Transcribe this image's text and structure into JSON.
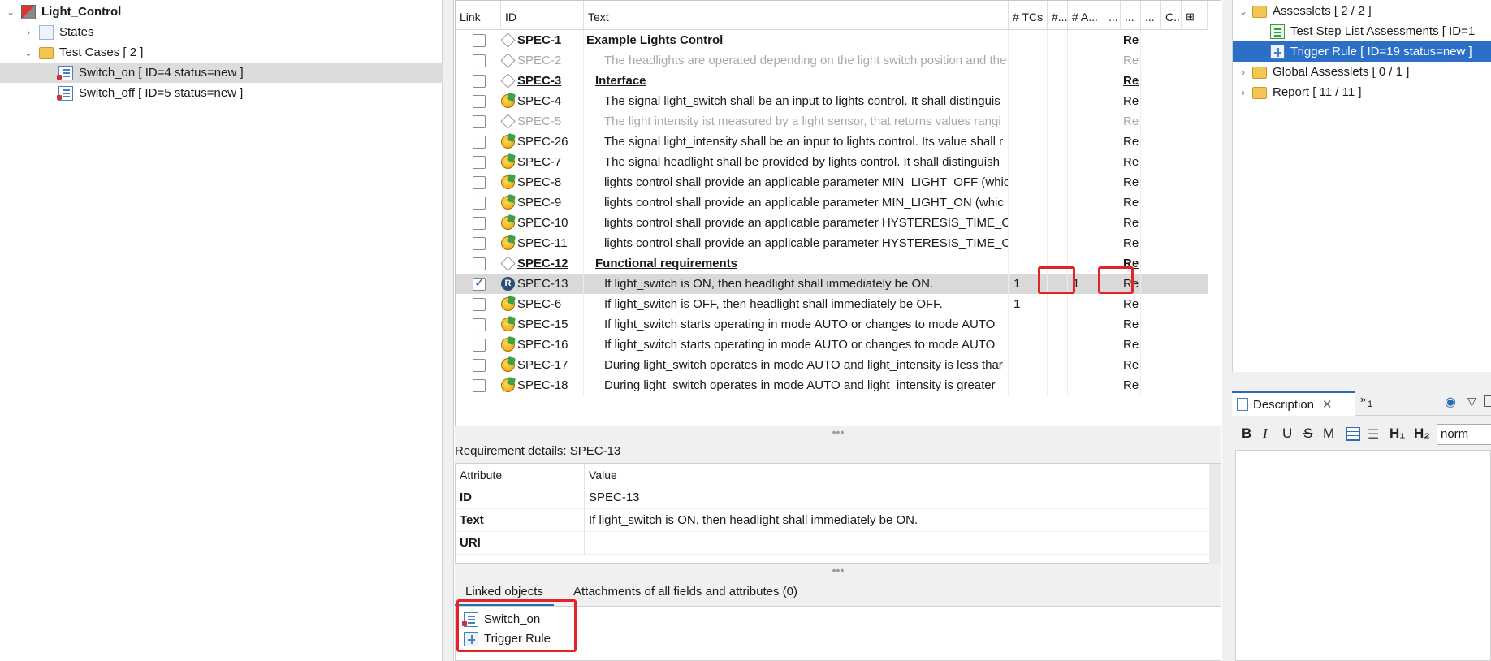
{
  "left_tree": {
    "root": "Light_Control",
    "states": "States",
    "test_cases": "Test Cases  [ 2 ]",
    "switch_on": "Switch_on  [ ID=4 status=new ]",
    "switch_off": "Switch_off  [ ID=5 status=new ]"
  },
  "grid": {
    "headers": [
      "Link",
      "ID",
      "Text",
      "# TCs",
      "#...",
      "# A...",
      "...",
      "...",
      "...",
      "C..."
    ],
    "rows": [
      {
        "id": "SPEC-1",
        "text": "Example Lights Control",
        "tcs": "",
        "a": "",
        "re": "Re",
        "checked": false,
        "icon": "diamond",
        "style": "heading"
      },
      {
        "id": "SPEC-2",
        "text": "The headlights are operated depending on the light switch position and the",
        "tcs": "",
        "a": "",
        "re": "Re",
        "checked": false,
        "icon": "diamond",
        "style": "grey"
      },
      {
        "id": "SPEC-3",
        "text": "Interface",
        "tcs": "",
        "a": "",
        "re": "Re",
        "checked": false,
        "icon": "diamond",
        "style": "heading2"
      },
      {
        "id": "SPEC-4",
        "text": "The signal light_switch shall be an input to lights control. It shall distinguis",
        "tcs": "",
        "a": "",
        "re": "Re",
        "checked": false,
        "icon": "bulb",
        "style": "normal"
      },
      {
        "id": "SPEC-5",
        "text": "The light intensity ist measured by a light sensor, that returns values rangi",
        "tcs": "",
        "a": "",
        "re": "Re",
        "checked": false,
        "icon": "diamond",
        "style": "grey"
      },
      {
        "id": "SPEC-26",
        "text": "The signal light_intensity shall be an input to lights control. Its value shall r",
        "tcs": "",
        "a": "",
        "re": "Re",
        "checked": false,
        "icon": "bulb",
        "style": "normal"
      },
      {
        "id": "SPEC-7",
        "text": "The signal headlight shall be provided by lights control. It shall distinguish",
        "tcs": "",
        "a": "",
        "re": "Re",
        "checked": false,
        "icon": "bulb",
        "style": "normal"
      },
      {
        "id": "SPEC-8",
        "text": "lights control shall provide an applicable parameter MIN_LIGHT_OFF (whic",
        "tcs": "",
        "a": "",
        "re": "Re",
        "checked": false,
        "icon": "bulb",
        "style": "normal"
      },
      {
        "id": "SPEC-9",
        "text": "lights control shall provide an applicable parameter MIN_LIGHT_ON (whic",
        "tcs": "",
        "a": "",
        "re": "Re",
        "checked": false,
        "icon": "bulb",
        "style": "normal"
      },
      {
        "id": "SPEC-10",
        "text": "lights control shall provide an applicable parameter HYSTERESIS_TIME_ON",
        "tcs": "",
        "a": "",
        "re": "Re",
        "checked": false,
        "icon": "bulb",
        "style": "normal"
      },
      {
        "id": "SPEC-11",
        "text": "lights control shall provide an applicable parameter HYSTERESIS_TIME_OF",
        "tcs": "",
        "a": "",
        "re": "Re",
        "checked": false,
        "icon": "bulb",
        "style": "normal"
      },
      {
        "id": "SPEC-12",
        "text": "Functional requirements",
        "tcs": "",
        "a": "",
        "re": "Re",
        "checked": false,
        "icon": "diamond",
        "style": "heading2"
      },
      {
        "id": "SPEC-13",
        "text": "If light_switch is ON, then headlight shall immediately be ON.",
        "tcs": "1",
        "a": "1",
        "re": "Re",
        "checked": true,
        "icon": "r",
        "style": "normal",
        "selected": true
      },
      {
        "id": "SPEC-6",
        "text": "If light_switch is OFF, then headlight shall immediately be OFF.",
        "tcs": "1",
        "a": "",
        "re": "Re",
        "checked": false,
        "icon": "bulb",
        "style": "normal"
      },
      {
        "id": "SPEC-15",
        "text": "If light_switch starts operating in mode AUTO or changes to mode AUTO",
        "tcs": "",
        "a": "",
        "re": "Re",
        "checked": false,
        "icon": "bulb",
        "style": "normal"
      },
      {
        "id": "SPEC-16",
        "text": "If light_switch starts operating in mode AUTO or changes to mode AUTO",
        "tcs": "",
        "a": "",
        "re": "Re",
        "checked": false,
        "icon": "bulb",
        "style": "normal"
      },
      {
        "id": "SPEC-17",
        "text": "During light_switch operates in mode AUTO and light_intensity is less thar",
        "tcs": "",
        "a": "",
        "re": "Re",
        "checked": false,
        "icon": "bulb",
        "style": "normal"
      },
      {
        "id": "SPEC-18",
        "text": "During light_switch operates in mode AUTO and light_intensity is greater",
        "tcs": "",
        "a": "",
        "re": "Re",
        "checked": false,
        "icon": "bulb",
        "style": "normal"
      }
    ]
  },
  "sash": "•••",
  "details": {
    "label": "Requirement details: SPEC-13",
    "header_attr": "Attribute",
    "header_value": "Value",
    "rows": [
      {
        "k": "ID",
        "v": "SPEC-13"
      },
      {
        "k": "Text",
        "v": "If light_switch is ON, then headlight shall immediately be ON."
      },
      {
        "k": "URI",
        "v": ""
      }
    ]
  },
  "bottom_tabs": {
    "linked": "Linked objects",
    "attachments": "Attachments of all fields and attributes (0)"
  },
  "linked_objects": [
    "Switch_on",
    "Trigger Rule"
  ],
  "right_tree": {
    "assesslets": "Assesslets  [ 2 / 2 ]",
    "tsla": "Test Step List Assessments  [ ID=1",
    "trigger": "Trigger Rule  [ ID=19 status=new ]",
    "global": "Global Assesslets  [ 0 / 1 ]",
    "report": "Report  [ 11 / 11 ]"
  },
  "description": {
    "tab": "Description",
    "overflow": "»",
    "overflow_count": "1",
    "toolbar": [
      "B",
      "I",
      "U",
      "S",
      "M"
    ],
    "h1": "H₁",
    "h2": "H₂",
    "format": "norm"
  },
  "colors": {
    "highlight": "#e5212a",
    "selection": "#2b6fc6"
  }
}
